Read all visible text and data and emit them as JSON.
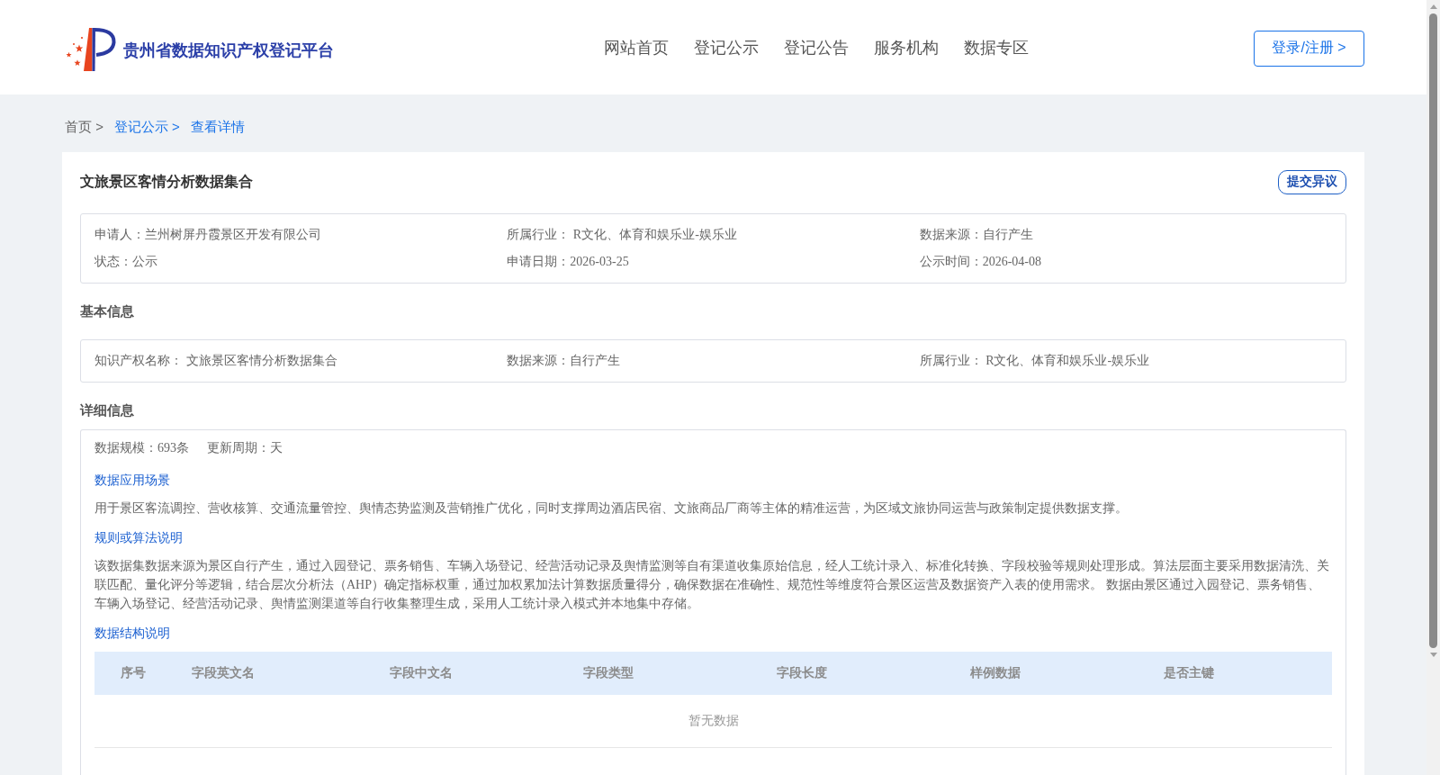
{
  "header": {
    "site_title": "贵州省数据知识产权登记平台",
    "nav": [
      {
        "label": "网站首页"
      },
      {
        "label": "登记公示"
      },
      {
        "label": "登记公告"
      },
      {
        "label": "服务机构"
      },
      {
        "label": "数据专区"
      }
    ],
    "login_button": "登录/注册 >"
  },
  "breadcrumb": [
    {
      "label": "首页 >",
      "kind": "plain"
    },
    {
      "label": "登记公示 >",
      "kind": "link"
    },
    {
      "label": "查看详情",
      "kind": "link"
    }
  ],
  "record": {
    "title": "文旅景区客情分析数据集合",
    "objection_button": "提交异议",
    "summary": [
      [
        "申请人：兰州树屏丹霞景区开发有限公司",
        "所属行业： R文化、体育和娱乐业-娱乐业",
        "数据来源：自行产生"
      ],
      [
        "状态：公示",
        "申请日期：2026-03-25",
        "公示时间：2026-04-08"
      ]
    ]
  },
  "basic_info": {
    "heading": "基本信息",
    "fields": [
      "知识产权名称： 文旅景区客情分析数据集合",
      "数据来源：自行产生",
      "所属行业： R文化、体育和娱乐业-娱乐业"
    ]
  },
  "detail_info": {
    "heading": "详细信息",
    "meta": [
      "数据规模：693条",
      "更新周期：天"
    ],
    "sections": [
      {
        "heading": "数据应用场景",
        "text": "用于景区客流调控、营收核算、交通流量管控、舆情态势监测及营销推广优化，同时支撑周边酒店民宿、文旅商品厂商等主体的精准运营，为区域文旅协同运营与政策制定提供数据支撑。"
      },
      {
        "heading": "规则或算法说明",
        "text": "该数据集数据来源为景区自行产生，通过入园登记、票务销售、车辆入场登记、经营活动记录及舆情监测等自有渠道收集原始信息，经人工统计录入、标准化转换、字段校验等规则处理形成。算法层面主要采用数据清洗、关联匹配、量化评分等逻辑，结合层次分析法（AHP）确定指标权重，通过加权累加法计算数据质量得分，确保数据在准确性、规范性等维度符合景区运营及数据资产入表的使用需求。 数据由景区通过入园登记、票务销售、车辆入场登记、经营活动记录、舆情监测渠道等自行收集整理生成，采用人工统计录入模式并本地集中存储。"
      }
    ],
    "structure": {
      "heading": "数据结构说明",
      "columns": [
        "序号",
        "字段英文名",
        "字段中文名",
        "字段类型",
        "字段长度",
        "样例数据",
        "是否主键"
      ],
      "empty_text": "暂无数据"
    }
  }
}
